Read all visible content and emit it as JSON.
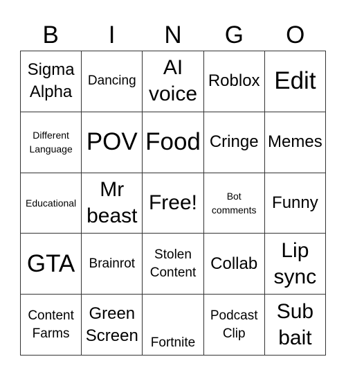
{
  "header": [
    "B",
    "I",
    "N",
    "G",
    "O"
  ],
  "cells": [
    {
      "text": "Sigma Alpha",
      "size": "md"
    },
    {
      "text": "Dancing",
      "size": "sm"
    },
    {
      "text": "AI voice",
      "size": "lg"
    },
    {
      "text": "Roblox",
      "size": "md"
    },
    {
      "text": "Edit",
      "size": "xl"
    },
    {
      "text": "Different Language",
      "size": "xs"
    },
    {
      "text": "POV",
      "size": "xl"
    },
    {
      "text": "Food",
      "size": "xl"
    },
    {
      "text": "Cringe",
      "size": "md"
    },
    {
      "text": "Memes",
      "size": "md"
    },
    {
      "text": "Educational",
      "size": "xs"
    },
    {
      "text": "Mr beast",
      "size": "lg"
    },
    {
      "text": "Free!",
      "size": "lg"
    },
    {
      "text": "Bot comments",
      "size": "xs"
    },
    {
      "text": "Funny",
      "size": "md"
    },
    {
      "text": "GTA",
      "size": "xl"
    },
    {
      "text": "Brainrot",
      "size": "sm"
    },
    {
      "text": "Stolen Content",
      "size": "sm"
    },
    {
      "text": "Collab",
      "size": "md"
    },
    {
      "text": "Lip sync",
      "size": "lg"
    },
    {
      "text": "Content Farms",
      "size": "sm"
    },
    {
      "text": "Green Screen",
      "size": "md"
    },
    {
      "text": "Fortnite",
      "size": "sm",
      "align": "bottom"
    },
    {
      "text": "Podcast Clip",
      "size": "sm"
    },
    {
      "text": "Sub bait",
      "size": "lg"
    }
  ]
}
